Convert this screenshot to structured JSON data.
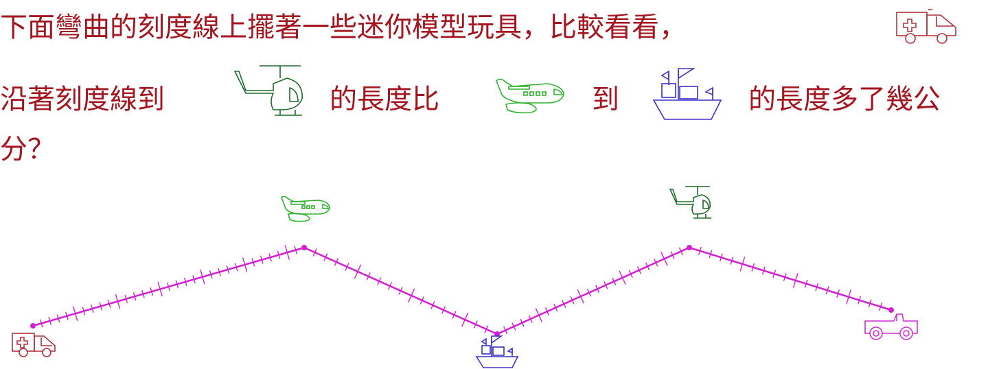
{
  "question": {
    "line1": "下面彎曲的刻度線上擺著一些迷你模型玩具，比較看看，",
    "line2_a": "沿著刻度線到",
    "line2_b": "的長度比",
    "line2_c": "到",
    "line2_d": "的長度多了幾公",
    "line3": "分？",
    "icons": [
      "ambulance-icon",
      "helicopter-icon",
      "airplane-icon",
      "ship-icon"
    ]
  },
  "colors": {
    "text": "#a4161f",
    "line": "#d21fd2",
    "ambulance": "#b0303a",
    "helicopter": "#1f6b2a",
    "airplane": "#2db42d",
    "ship": "#3a32c8",
    "jeep": "#d02ed0"
  },
  "ruler": {
    "tick_unit": "1 cm",
    "major_every": 5,
    "segments_cm": [
      32,
      18,
      23,
      19
    ],
    "points": [
      "ambulance",
      "airplane",
      "ship",
      "helicopter",
      "jeep"
    ]
  }
}
